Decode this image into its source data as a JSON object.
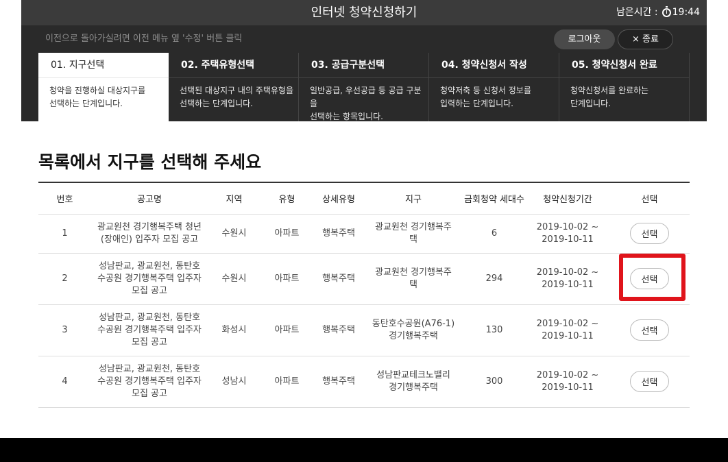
{
  "header": {
    "title": "인터넷 청약신청하기",
    "timer_label": "남은시간 :",
    "timer_value": "19:44"
  },
  "subbar": {
    "hint": "이전으로 돌아가실려면 이전 메뉴 옆 '수정' 버튼 클릭",
    "logout_label": "로그아웃",
    "exit_label": "× 종료"
  },
  "steps": [
    {
      "title": "01. 지구선택",
      "desc1": "청약을 진행하실 대상지구를",
      "desc2": "선택하는 단계입니다."
    },
    {
      "title": "02. 주택유형선택",
      "desc1": "선택된 대상지구 내의 주택유형을",
      "desc2": "선택하는 단계입니다."
    },
    {
      "title": "03. 공급구분선택",
      "desc1": "일반공급, 우선공급 등 공급 구분을",
      "desc2": "선택하는 항목입니다."
    },
    {
      "title": "04. 청약신청서 작성",
      "desc1": "청약저축 등 신청서 정보를",
      "desc2": "입력하는 단계입니다."
    },
    {
      "title": "05. 청약신청서 완료",
      "desc1": "청약신청서를 완료하는",
      "desc2": "단계입니다."
    }
  ],
  "main": {
    "heading": "목록에서 지구를 선택해 주세요"
  },
  "table": {
    "headers": [
      "번호",
      "공고명",
      "지역",
      "유형",
      "상세유형",
      "지구",
      "금회청약 세대수",
      "청약신청기간",
      "선택"
    ],
    "rows": [
      {
        "no": "1",
        "name1": "광교원천 경기행복주택 청년",
        "name2": "(장애인) 입주자 모집 공고",
        "name3": "",
        "region": "수원시",
        "type": "아파트",
        "detail": "행복주택",
        "district1": "광교원천 경기행복주",
        "district2": "택",
        "count": "6",
        "period1": "2019-10-02 ~",
        "period2": "2019-10-11",
        "button": "선택"
      },
      {
        "no": "2",
        "name1": "성남판교, 광교원천, 동탄호",
        "name2": "수공원 경기행복주택 입주자",
        "name3": "모집 공고",
        "region": "수원시",
        "type": "아파트",
        "detail": "행복주택",
        "district1": "광교원천 경기행복주",
        "district2": "택",
        "count": "294",
        "period1": "2019-10-02 ~",
        "period2": "2019-10-11",
        "button": "선택"
      },
      {
        "no": "3",
        "name1": "성남판교, 광교원천, 동탄호",
        "name2": "수공원 경기행복주택 입주자",
        "name3": "모집 공고",
        "region": "화성시",
        "type": "아파트",
        "detail": "행복주택",
        "district1": "동탄호수공원(A76-1)",
        "district2": "경기행복주택",
        "count": "130",
        "period1": "2019-10-02 ~",
        "period2": "2019-10-11",
        "button": "선택"
      },
      {
        "no": "4",
        "name1": "성남판교, 광교원천, 동탄호",
        "name2": "수공원 경기행복주택 입주자",
        "name3": "모집 공고",
        "region": "성남시",
        "type": "아파트",
        "detail": "행복주택",
        "district1": "성남판교테크노밸리",
        "district2": "경기행복주택",
        "count": "300",
        "period1": "2019-10-02 ~",
        "period2": "2019-10-11",
        "button": "선택"
      }
    ]
  },
  "colors": {
    "titlebar": "#3b3b3b",
    "dark_panel": "#2a2a2a",
    "highlight": "#e0141b"
  },
  "highlighted_row": 2
}
